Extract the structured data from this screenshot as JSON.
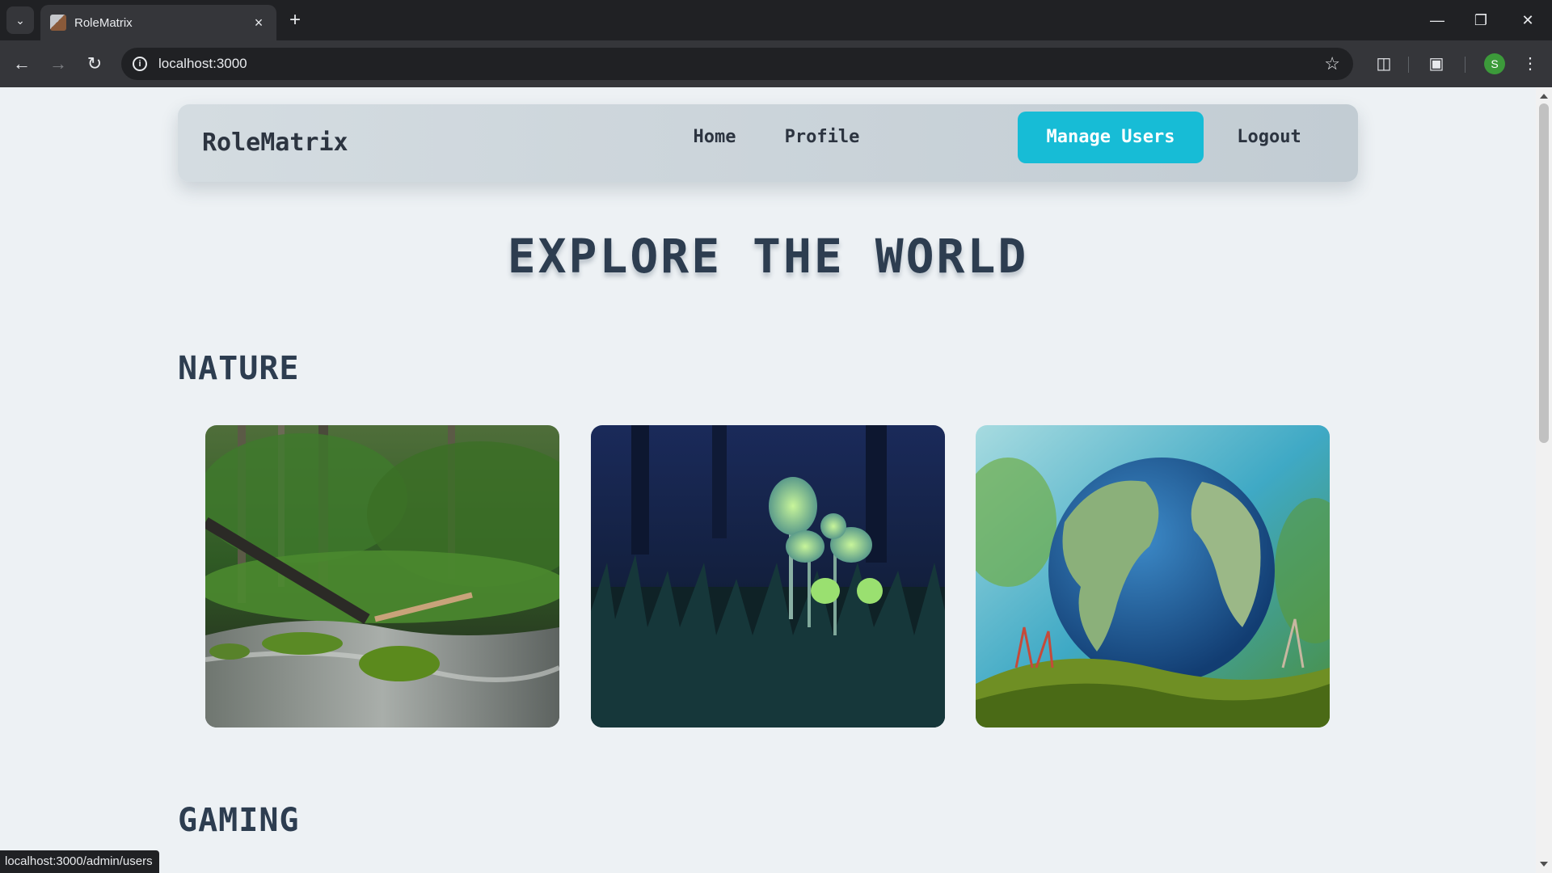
{
  "browser": {
    "tab_title": "RoleMatrix",
    "url": "localhost:3000",
    "profile_initial": "S",
    "status_url": "localhost:3000/admin/users"
  },
  "navbar": {
    "brand": "RoleMatrix",
    "links": [
      "Home",
      "Profile",
      "Manage Users",
      "Logout"
    ],
    "active_link": "Manage Users",
    "accent_color": "#17bcd6"
  },
  "page": {
    "hero_title": "EXPLORE THE WORLD",
    "sections": [
      {
        "title": "NATURE",
        "images": [
          "forest-stream",
          "glowing-mushrooms",
          "earth-globe-on-moss"
        ]
      },
      {
        "title": "GAMING"
      }
    ]
  }
}
